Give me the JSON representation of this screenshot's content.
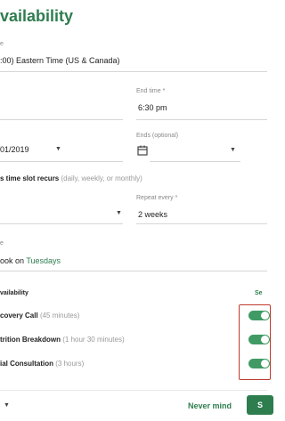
{
  "header": {
    "title": "vailability"
  },
  "timezone": {
    "label": "e",
    "value": ":00) Eastern Time (US & Canada)"
  },
  "row1": {
    "left_label": "",
    "end_time_label": "End time *",
    "end_time_value": "6:30 pm"
  },
  "row2": {
    "date_value": "01/2019",
    "ends_label": "Ends (optional)",
    "ends_value": ""
  },
  "recur": {
    "heading": "s time slot recurs",
    "hint": "(daily, weekly, or monthly)",
    "repeat_every_label": "Repeat every *",
    "repeat_every_value": "2 weeks"
  },
  "weekday": {
    "label": "e",
    "prefix": "ook on ",
    "day": "Tuesdays"
  },
  "availability": {
    "heading": "vailability",
    "select_label": "Se",
    "items": [
      {
        "name": "covery Call",
        "duration": "(45 minutes)",
        "on": true
      },
      {
        "name": "trition Breakdown",
        "duration": "(1 hour 30 minutes)",
        "on": true
      },
      {
        "name": "ial Consultation",
        "duration": "(3 hours)",
        "on": true
      }
    ]
  },
  "footer": {
    "never_mind_label": "Never mind",
    "save_label": "S"
  },
  "colors": {
    "accent": "#2e7d4f",
    "toggle_on": "#3f9b63",
    "highlight": "#c0392b"
  }
}
